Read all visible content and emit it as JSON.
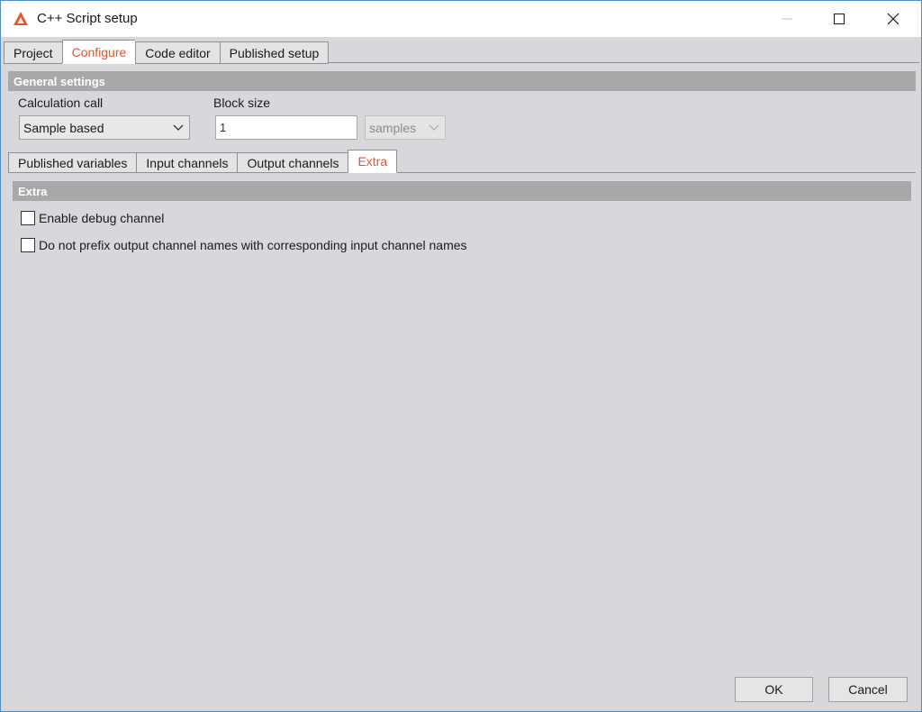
{
  "window": {
    "title": "C++ Script setup",
    "accent_color": "#e8522d"
  },
  "top_tabs": [
    {
      "label": "Project",
      "active": false
    },
    {
      "label": "Configure",
      "active": true
    },
    {
      "label": "Code editor",
      "active": false
    },
    {
      "label": "Published setup",
      "active": false
    }
  ],
  "general_settings": {
    "header": "General settings",
    "calculation_call": {
      "label": "Calculation call",
      "value": "Sample based"
    },
    "block_size": {
      "label": "Block size",
      "value": "1",
      "unit": "samples"
    }
  },
  "sub_tabs": [
    {
      "label": "Published variables",
      "active": false
    },
    {
      "label": "Input channels",
      "active": false
    },
    {
      "label": "Output channels",
      "active": false
    },
    {
      "label": "Extra",
      "active": true
    }
  ],
  "extra": {
    "header": "Extra",
    "options": [
      {
        "label": "Enable debug channel",
        "checked": false
      },
      {
        "label": "Do not prefix output channel names with corresponding input channel names",
        "checked": false
      }
    ]
  },
  "footer": {
    "ok_label": "OK",
    "cancel_label": "Cancel"
  }
}
